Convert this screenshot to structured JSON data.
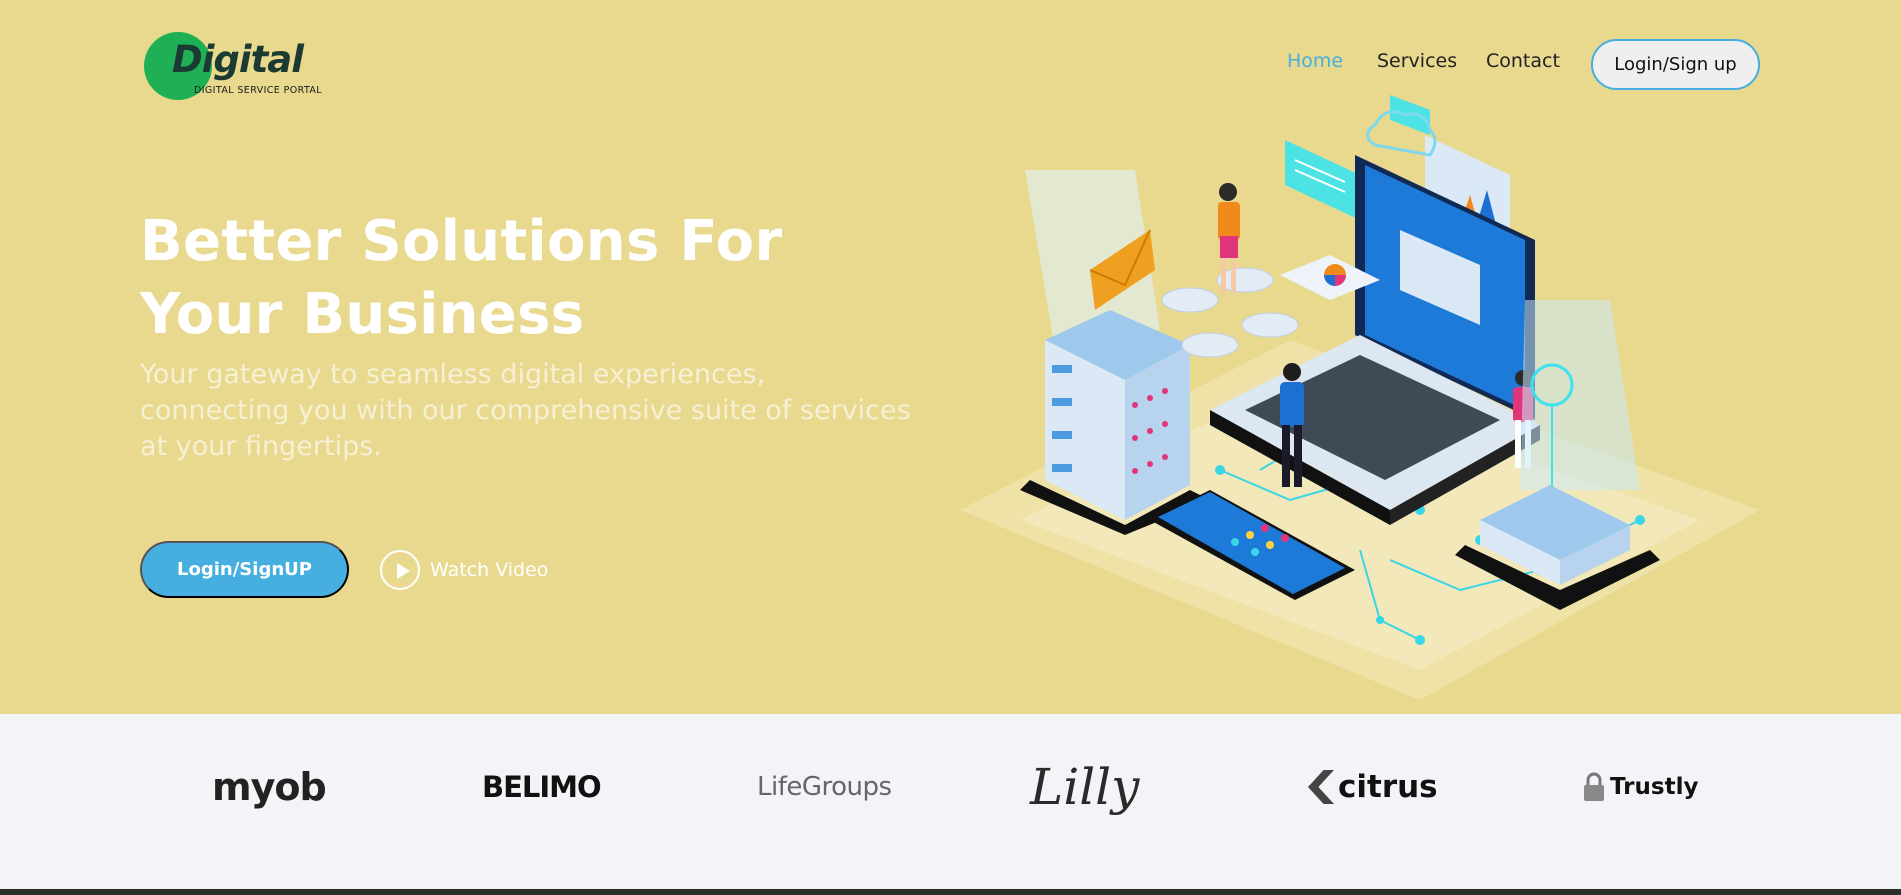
{
  "header": {
    "logo_text": "Digital",
    "logo_tagline": "DIGITAL SERVICE PORTAL",
    "nav": [
      {
        "label": "Home",
        "active": true
      },
      {
        "label": "Services",
        "active": false
      },
      {
        "label": "Contact",
        "active": false
      }
    ],
    "login_button": "Login/Sign up"
  },
  "hero": {
    "headline": "Better Solutions For Your Business",
    "subtitle": "Your gateway to seamless digital experiences, connecting you with our comprehensive suite of services at your fingertips.",
    "cta_label": "Login/SignUP",
    "watch_label": "Watch Video",
    "illustration_icon": "isometric-laptop-servers-illustration"
  },
  "partners": [
    {
      "name": "myob"
    },
    {
      "name": "BELIMO"
    },
    {
      "name": "LifeGroups"
    },
    {
      "name": "Lilly"
    },
    {
      "name": "citrus"
    },
    {
      "name": "Trustly"
    }
  ],
  "colors": {
    "hero_bg": "#e8d98f",
    "accent": "#47aee0",
    "logo_green": "#1fb055",
    "partners_bg": "#f2f4f8"
  }
}
